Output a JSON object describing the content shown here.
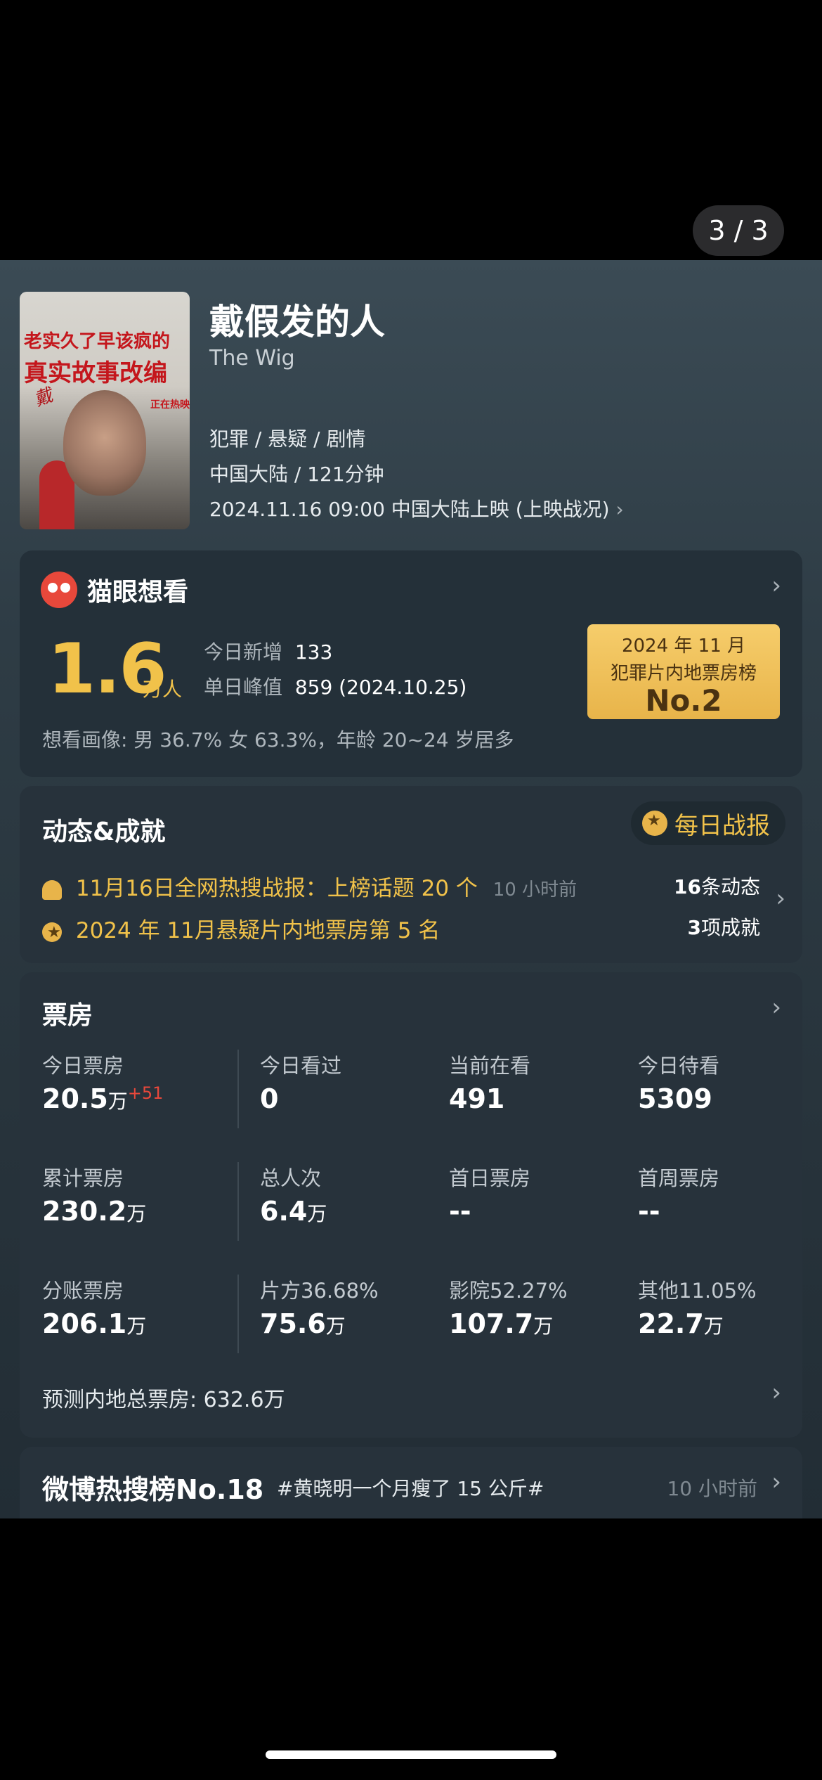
{
  "pager": "3 / 3",
  "movie": {
    "title": "戴假发的人",
    "subtitle": "The Wig",
    "genres": "犯罪 / 悬疑 / 剧情",
    "region_duration": "中国大陆 / 121分钟",
    "release": "2024.11.16 09:00 中国大陆上映 (上映战况)",
    "poster": {
      "line1": "老实久了早该疯的",
      "line2": "真实故事改编",
      "tag": "正在热映"
    }
  },
  "want": {
    "title": "猫眼想看",
    "value": "1.6",
    "unit": "万人",
    "today_label": "今日新增",
    "today_value": "133",
    "peak_label": "单日峰值",
    "peak_value": "859 (2024.10.25)",
    "profile": "想看画像: 男 36.7%  女 63.3%，年龄 20~24 岁居多",
    "rank_line1": "2024 年 11 月",
    "rank_line2": "犯罪片内地票房榜",
    "rank_no": "No.2"
  },
  "news": {
    "title": "动态&成就",
    "daily_btn": "每日战报",
    "item1": "11月16日全网热搜战报：上榜话题 20 个",
    "item1_time": "10 小时前",
    "item2": "2024 年 11月悬疑片内地票房第 5 名",
    "count1": "16",
    "count1_suffix": "条动态",
    "count2": "3",
    "count2_suffix": "项成就"
  },
  "box": {
    "title": "票房",
    "rows": [
      [
        {
          "label": "今日票房",
          "value": "20.5",
          "unit": "万",
          "delta": "+51"
        },
        {
          "label": "今日看过",
          "value": "0",
          "unit": ""
        },
        {
          "label": "当前在看",
          "value": "491",
          "unit": ""
        },
        {
          "label": "今日待看",
          "value": "5309",
          "unit": ""
        }
      ],
      [
        {
          "label": "累计票房",
          "value": "230.2",
          "unit": "万"
        },
        {
          "label": "总人次",
          "value": "6.4",
          "unit": "万"
        },
        {
          "label": "首日票房",
          "value": "--",
          "unit": ""
        },
        {
          "label": "首周票房",
          "value": "--",
          "unit": ""
        }
      ],
      [
        {
          "label": "分账票房",
          "value": "206.1",
          "unit": "万"
        },
        {
          "label": "片方36.68%",
          "value": "75.6",
          "unit": "万"
        },
        {
          "label": "影院52.27%",
          "value": "107.7",
          "unit": "万"
        },
        {
          "label": "其他11.05%",
          "value": "22.7",
          "unit": "万"
        }
      ]
    ],
    "forecast": "预测内地总票房:  632.6万"
  },
  "weibo": {
    "title": "微博热搜榜No.18",
    "topic": "#黄晓明一个月瘦了 15 公斤#",
    "time": "10 小时前"
  },
  "colors": {
    "gold": "#f1c24a",
    "background": "#27323b"
  }
}
